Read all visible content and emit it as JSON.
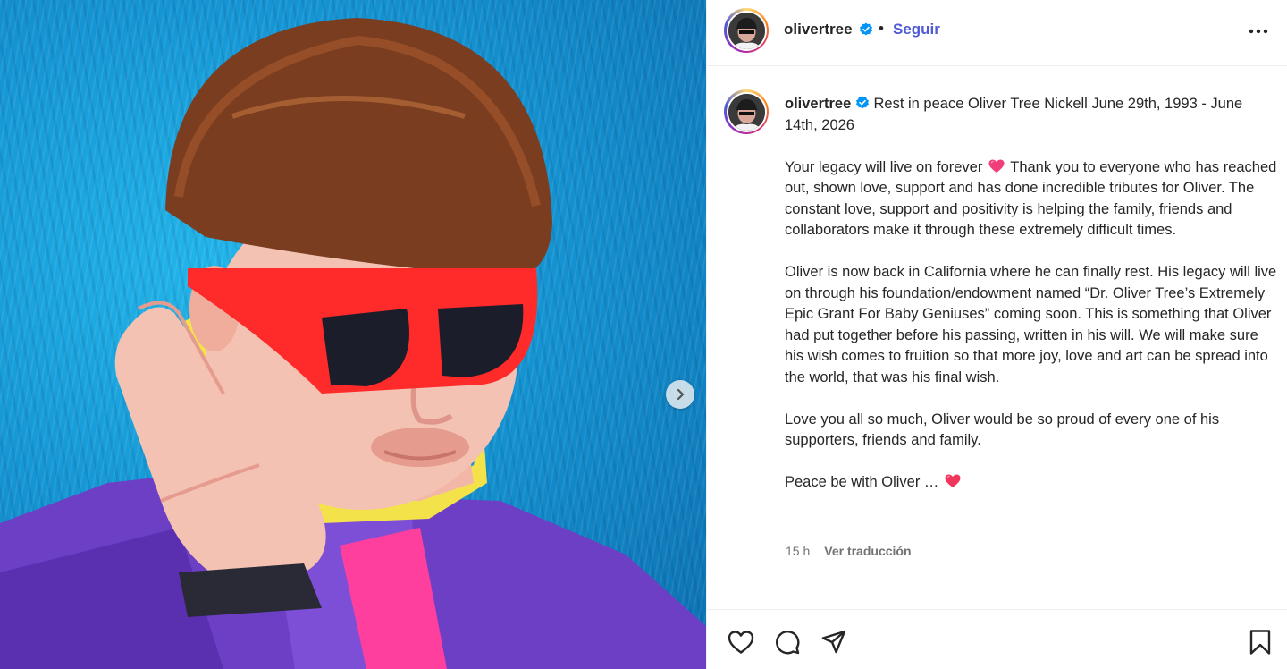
{
  "post": {
    "username": "olivertree",
    "verified": true,
    "separator": "•",
    "follow_label": "Seguir",
    "caption_intro": "Rest in peace Oliver Tree Nickell June 29th, 1993 - June 14th, 2026",
    "paragraphs": {
      "p1_before_heart": "Your legacy will live on forever",
      "p1_after_heart": "Thank you to everyone who has reached out, shown love, support and has done incredible tributes for Oliver. The constant love, support and positivity is helping the family, friends and collaborators make it through these extremely difficult times.",
      "p2": "Oliver is now back in California where he can finally rest. His legacy will live on through his foundation/endowment named “Dr. Oliver Tree’s Extremely Epic Grant For Baby Geniuses” coming soon. This is something that Oliver had put together before his passing, written in his will. We will make sure his wish comes to fruition so that more joy, love and art can be spread into the world, that was his final wish.",
      "p3": "Love you all so much, Oliver would be so proud of every one of his supporters, friends and family.",
      "p4": "Peace be with Oliver …"
    },
    "time_ago": "15 h",
    "translate_label": "Ver traducción"
  },
  "icons": {
    "more": "more-options-icon",
    "next": "chevron-right-icon",
    "like": "heart-icon",
    "comment": "comment-icon",
    "share": "share-icon",
    "save": "bookmark-icon",
    "emoji": "pink-heart-emoji"
  },
  "colors": {
    "accent_blue": "#4f5bd5",
    "verified_blue": "#0095f6",
    "emoji_pink": "#f03e7a",
    "muted_text": "#737373"
  }
}
